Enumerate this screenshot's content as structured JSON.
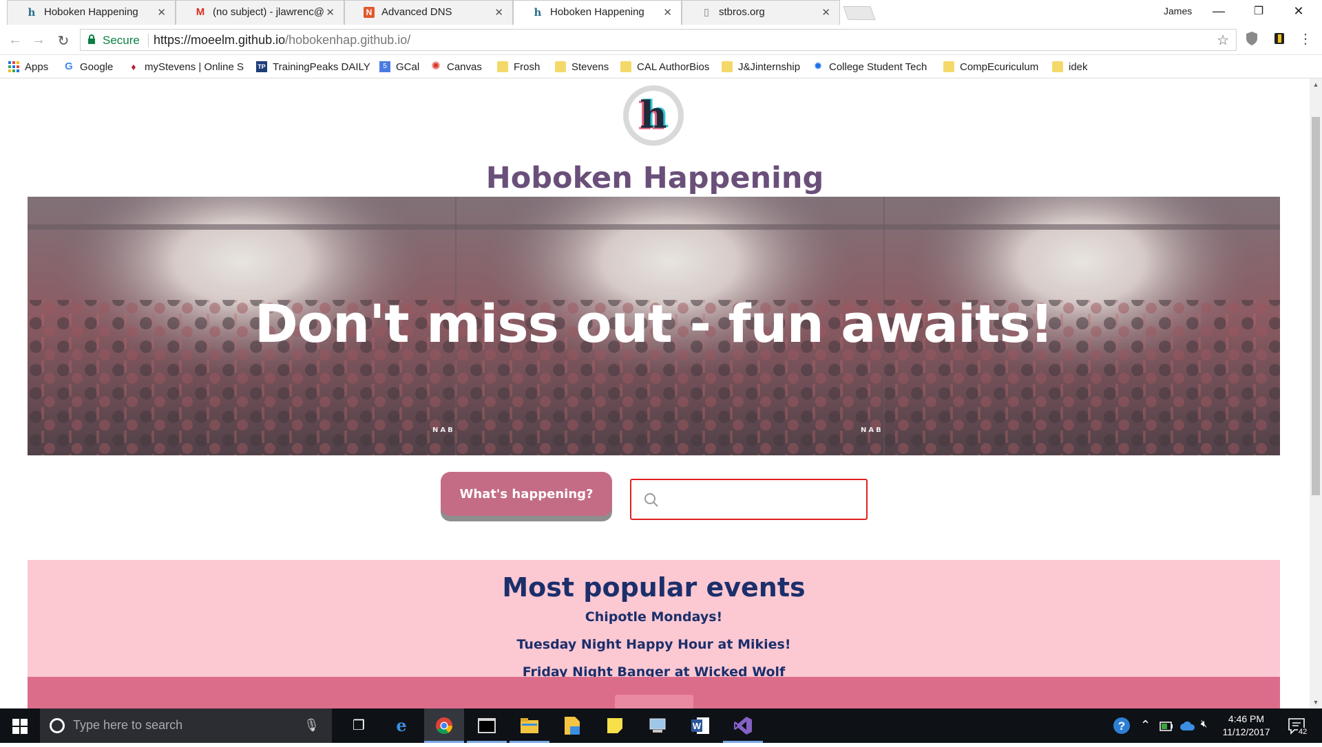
{
  "browser": {
    "tabs": [
      {
        "title": "Hoboken Happening",
        "favicon": "hoboken-h-icon",
        "active": false
      },
      {
        "title": "(no subject) - jlawrenc@",
        "favicon": "gmail-icon",
        "active": false
      },
      {
        "title": "Advanced DNS",
        "favicon": "namecheap-icon",
        "active": false
      },
      {
        "title": "Hoboken Happening",
        "favicon": "hoboken-h-icon",
        "active": true
      },
      {
        "title": "stbros.org",
        "favicon": "page-icon",
        "active": false
      }
    ],
    "profile_name": "James",
    "address": {
      "secure_label": "Secure",
      "url_host": "https://moeelm.github.io",
      "url_path": "/hobokenhap.github.io/"
    },
    "bookmarks": [
      {
        "label": "Apps",
        "icon": "apps-grid-icon"
      },
      {
        "label": "Google",
        "icon": "google-icon"
      },
      {
        "label": "myStevens | Online S",
        "icon": "stevens-icon"
      },
      {
        "label": "TrainingPeaks DAILY",
        "icon": "trainingpeaks-icon"
      },
      {
        "label": "GCal",
        "icon": "calendar-icon"
      },
      {
        "label": "Canvas",
        "icon": "canvas-icon"
      },
      {
        "label": "Frosh",
        "icon": "folder-icon"
      },
      {
        "label": "Stevens",
        "icon": "folder-icon"
      },
      {
        "label": "CAL AuthorBios",
        "icon": "folder-icon"
      },
      {
        "label": "J&Jinternship",
        "icon": "folder-icon"
      },
      {
        "label": "College Student Tech",
        "icon": "lightbulb-icon"
      },
      {
        "label": "CompEcuriculum",
        "icon": "folder-icon"
      },
      {
        "label": "idek",
        "icon": "folder-icon"
      }
    ]
  },
  "site": {
    "logo_letter": "h",
    "title": "Hoboken Happening",
    "hero": {
      "caption": "Don't miss out - fun awaits!",
      "watermark": "NAB"
    },
    "cta_label": "What's happening?",
    "search": {
      "value": "",
      "placeholder": ""
    },
    "popular": {
      "title": "Most popular events",
      "items": [
        "Chipotle Mondays!",
        "Tuesday Night Happy Hour at Mikies!",
        "Friday Night Banger at Wicked Wolf"
      ]
    }
  },
  "taskbar": {
    "search_placeholder": "Type here to search",
    "apps": [
      "task-view-icon",
      "edge-icon",
      "chrome-icon",
      "terminal-icon",
      "file-explorer-icon",
      "file-icon",
      "sticky-notes-icon",
      "network-icon",
      "word-icon",
      "visual-studio-icon"
    ],
    "clock_time": "4:46 PM",
    "clock_date": "11/12/2017",
    "notification_count": "42"
  },
  "colors": {
    "title_purple": "#6a4f7a",
    "cta_pink": "#c46c85",
    "popular_bg": "#fcc8d2",
    "popular_text": "#1b2f6b",
    "band_pink": "#db6d8b",
    "search_border": "#e02020"
  }
}
